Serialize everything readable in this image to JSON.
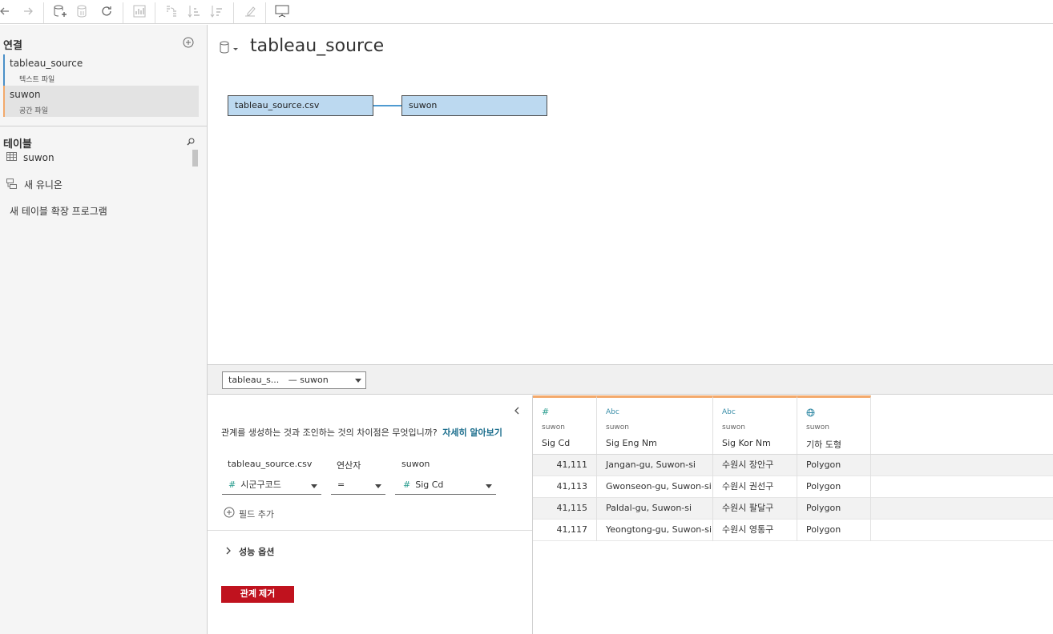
{
  "connections": {
    "title": "연결",
    "items": [
      {
        "name": "tableau_source",
        "type": "텍스트 파일",
        "color": "#4a90c8"
      },
      {
        "name": "suwon",
        "type": "공간 파일",
        "color": "#f3a96b"
      }
    ]
  },
  "tables": {
    "title": "테이블",
    "items": [
      {
        "name": "suwon"
      }
    ],
    "new_union": "새 유니온",
    "new_extension": "새 테이블 확장 프로그램"
  },
  "canvas": {
    "datasource_title": "tableau_source",
    "tiles": [
      {
        "label": "tableau_source.csv"
      },
      {
        "label": "suwon"
      }
    ]
  },
  "relationship": {
    "selector": {
      "left": "tableau_s...",
      "right": "— suwon"
    },
    "info_text": "관계를 생성하는 것과 조인하는 것의 차이점은 무엇입니까?",
    "learn_more": "자세히 알아보기",
    "left_table": "tableau_source.csv",
    "operator_label": "연산자",
    "right_table": "suwon",
    "left_field": "시군구코드",
    "operator": "=",
    "right_field": "Sig Cd",
    "add_field": "필드 추가",
    "performance_options": "성능 옵션",
    "remove_button": "관계 제거"
  },
  "grid": {
    "columns": [
      {
        "icon": "#",
        "source": "suwon",
        "name": "Sig Cd"
      },
      {
        "icon": "Abc",
        "source": "suwon",
        "name": "Sig Eng Nm"
      },
      {
        "icon": "Abc",
        "source": "suwon",
        "name": "Sig Kor Nm"
      },
      {
        "icon": "globe",
        "source": "suwon",
        "name": "기하 도형"
      }
    ],
    "rows": [
      [
        "41,111",
        "Jangan-gu, Suwon-si",
        "수원시 장안구",
        "Polygon"
      ],
      [
        "41,113",
        "Gwonseon-gu, Suwon-si",
        "수원시 권선구",
        "Polygon"
      ],
      [
        "41,115",
        "Paldal-gu, Suwon-si",
        "수원시 팔달구",
        "Polygon"
      ],
      [
        "41,117",
        "Yeongtong-gu, Suwon-si",
        "수원시 영통구",
        "Polygon"
      ]
    ]
  },
  "colors": {
    "tile_fill": "#bcd9f0",
    "link": "#4f9bd1",
    "accent_orange": "#f3a96b",
    "remove_red": "#c0121e",
    "learn_more": "#1a6d8c"
  }
}
